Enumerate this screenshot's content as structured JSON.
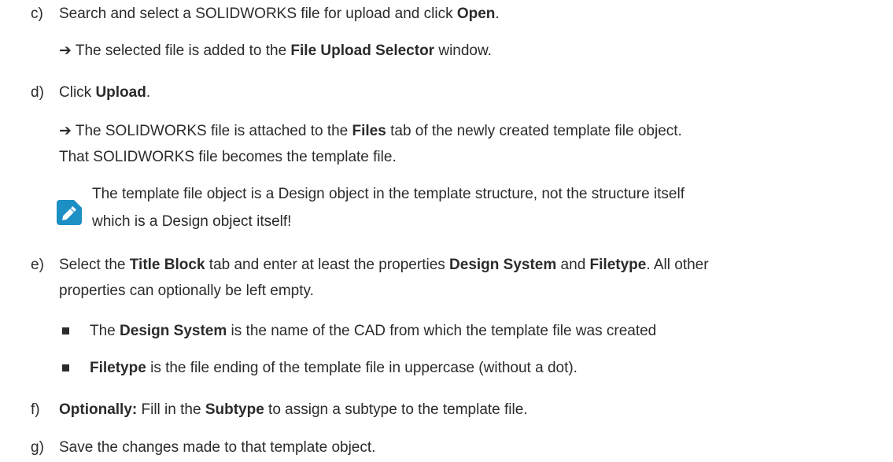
{
  "steps": {
    "c": {
      "marker": "c)",
      "t1": "Search and select a SOLIDWORKS file for upload and click ",
      "b1": "Open",
      "t2": "."
    },
    "c_result": {
      "arrow": "➔",
      "t1": " The selected file is added to the ",
      "b1": "File Upload Selector",
      "t2": " window."
    },
    "d": {
      "marker": "d)",
      "t1": "Click ",
      "b1": "Upload",
      "t2": "."
    },
    "d_result": {
      "arrow": "➔",
      "t1": " The SOLIDWORKS file is attached to the ",
      "b1": "Files",
      "t2": " tab of the newly created template file object.",
      "line2": "That SOLIDWORKS file becomes the template file."
    },
    "note": {
      "icon": "pencil-icon",
      "line1": "The template file object is a Design object in the template structure, not the structure itself",
      "line2": "which is a Design object itself!"
    },
    "e": {
      "marker": "e)",
      "t1": "Select the ",
      "b1": "Title Block",
      "t2": " tab and enter at least the properties ",
      "b2": "Design System",
      "t3": " and ",
      "b3": "Filetype",
      "t4": ". All other",
      "line2": "properties can optionally be left empty."
    },
    "e_bullet1": {
      "t1": "The ",
      "b1": "Design System",
      "t2": " is the name of the CAD from which the template file was created"
    },
    "e_bullet2": {
      "b1": "Filetype",
      "t1": " is the file ending of the template file in uppercase (without a dot)."
    },
    "f": {
      "marker": "f)",
      "b1": "Optionally:",
      "t1": " Fill in the ",
      "b2": "Subtype",
      "t2": " to assign a subtype to the template file."
    },
    "g": {
      "marker": "g)",
      "t1": "Save the changes made to that template object."
    }
  },
  "colors": {
    "text": "#2b2b2b",
    "note_icon_bg": "#1c8fc4"
  }
}
